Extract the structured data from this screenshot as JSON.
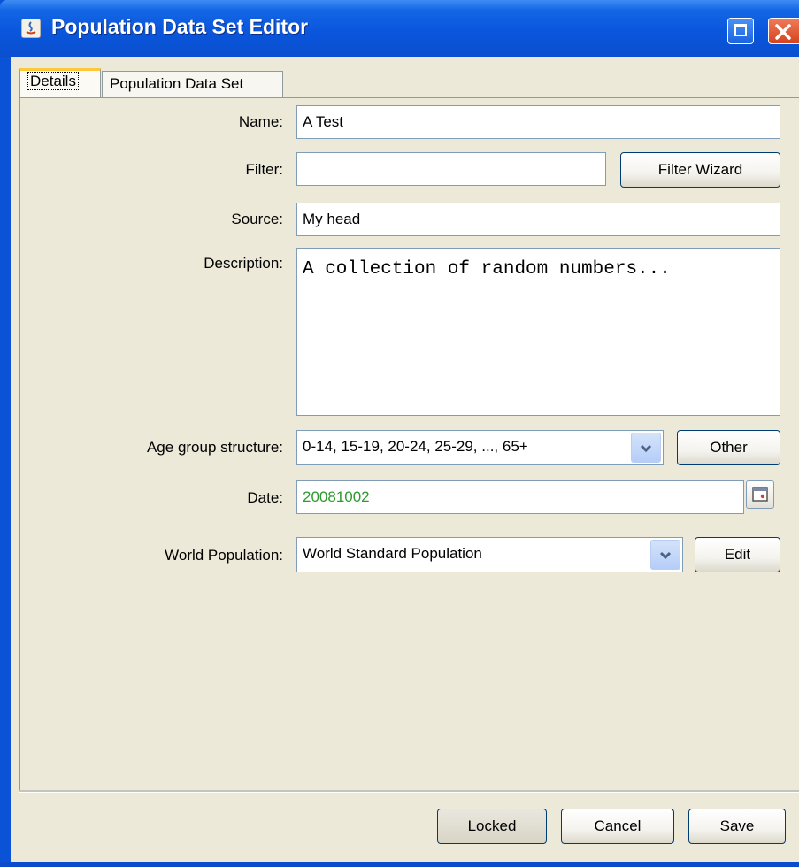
{
  "window": {
    "title": "Population Data Set Editor"
  },
  "tabs": [
    {
      "label": "Details",
      "selected": true
    },
    {
      "label": "Population Data Set",
      "selected": false
    }
  ],
  "form": {
    "name": {
      "label": "Name:",
      "value": "A Test"
    },
    "filter": {
      "label": "Filter:",
      "value": "",
      "button": "Filter Wizard"
    },
    "source": {
      "label": "Source:",
      "value": "My head"
    },
    "description": {
      "label": "Description:",
      "value": "A collection of random numbers..."
    },
    "age_group": {
      "label": "Age group structure:",
      "value": "0-14, 15-19, 20-24, 25-29, ..., 65+",
      "button": "Other"
    },
    "date": {
      "label": "Date:",
      "value": "20081002",
      "value_color": "#2d9a2d"
    },
    "world_population": {
      "label": "World Population:",
      "value": "World Standard Population",
      "button": "Edit"
    }
  },
  "footer": {
    "locked": "Locked",
    "cancel": "Cancel",
    "save": "Save"
  },
  "colors": {
    "titlebar": "#0a56dd",
    "panel": "#ece9d8",
    "close": "#d4431e"
  }
}
